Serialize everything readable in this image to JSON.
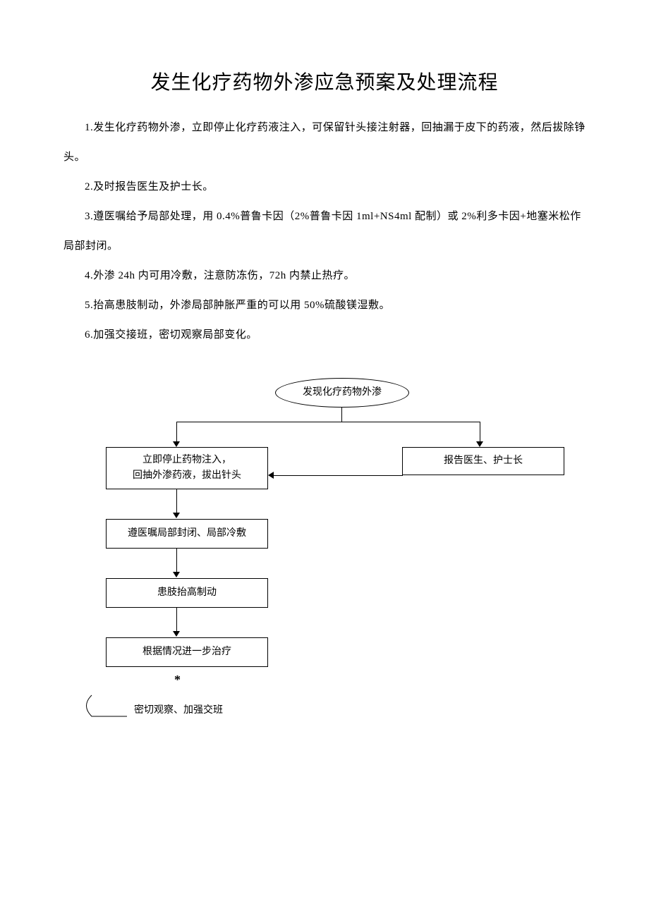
{
  "title": "发生化疗药物外渗应急预案及处理流程",
  "paragraphs": {
    "p1": "1.发生化疗药物外渗，立即停止化疗药液注入，可保留针头接注射器，回抽漏于皮下的药液，然后拔除铮头。",
    "p2": "2.及时报告医生及护士长。",
    "p3": "3.遵医嘱给予局部处理，用 0.4%普鲁卡因（2%普鲁卡因 1ml+NS4ml 配制）或 2%利多卡因+地塞米松作局部封闭。",
    "p4": "4.外渗 24h 内可用冷敷，注意防冻伤，72h 内禁止热疗。",
    "p5": "5.抬高患肢制动，外渗局部肿胀严重的可以用 50%硫酸镁湿敷。",
    "p6": "6.加强交接班，密切观察局部变化。"
  },
  "flowchart": {
    "start": "发现化疗药物外渗",
    "box1_line1": "立即停止药物注入，",
    "box1_line2": "回抽外渗药液，拔出针头",
    "box2": "报告医生、护士长",
    "box3": "遵医嘱局部封闭、局部冷敷",
    "box4": "患肢抬高制动",
    "box5": "根据情况进一步治疗",
    "star": "*",
    "final": "密切观察、加强交班"
  }
}
